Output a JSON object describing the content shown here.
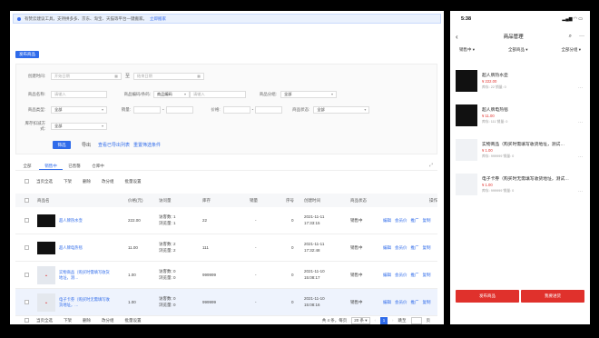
{
  "notice": {
    "text": "有赞云建议工具，支持拼多多、京东、淘宝、天猫等平台一键搬家。",
    "link": "立即搬家"
  },
  "publish_btn": "发布商品",
  "filters": {
    "created_label": "创建时间:",
    "start_ph": "开始日期",
    "to": "至",
    "end_ph": "结束日期",
    "name_label": "商品名称:",
    "name_ph": "请输入",
    "code_label": "商品编码/条码:",
    "code_select": "商品编码",
    "code_ph": "请输入",
    "group_label": "商品分组:",
    "group_val": "全部",
    "type_label": "商品类型:",
    "type_val": "全部",
    "sales_label": "销量:",
    "sales_sep": "-",
    "price_label": "价格:",
    "price_sep": "-",
    "status_label": "商品状态:",
    "status_val": "全部",
    "delivery_label": "库存扣减方式:",
    "delivery_val": "全部",
    "filter_btn": "筛选",
    "export_btn": "导出",
    "view_export": "查看已导出列表",
    "reset": "重置筛选条件"
  },
  "tabs": [
    "全部",
    "销售中",
    "已售罄",
    "仓库中"
  ],
  "actions": [
    "当页全选",
    "下架",
    "删除",
    "改分组",
    "批量设置"
  ],
  "columns": [
    "商品名",
    "价格(元)",
    "访问量",
    "库存",
    "销量",
    "序号",
    "创建时间",
    "商品状态",
    "操作"
  ],
  "rows": [
    {
      "name": "超人牌热水壶",
      "price": "222.00",
      "uv": "访客数: 1",
      "pv": "浏览量: 1",
      "stock": "22",
      "sales": "-",
      "seq": "0",
      "date": "2021-11-11",
      "time": "17:33:15",
      "status": "销售中"
    },
    {
      "name": "超人牌电热毯",
      "price": "11.00",
      "uv": "访客数: 2",
      "pv": "浏览量: 2",
      "stock": "111",
      "sales": "-",
      "seq": "0",
      "date": "2021-11-11",
      "time": "17:32:48",
      "status": "销售中"
    },
    {
      "name": "实物商品（购买时需填写收货地址，测…",
      "price": "1.00",
      "uv": "访客数: 0",
      "pv": "浏览量: 0",
      "stock": "999999",
      "sales": "-",
      "seq": "0",
      "date": "2021-11-10",
      "time": "15:08:17",
      "status": "销售中"
    },
    {
      "name": "电子卡券（购买时无需填写收货地址，…",
      "price": "1.00",
      "uv": "访客数: 0",
      "pv": "浏览量: 0",
      "stock": "999999",
      "sales": "-",
      "seq": "0",
      "date": "2021-11-10",
      "time": "15:08:16",
      "status": "销售中"
    }
  ],
  "row_ops": [
    "编辑",
    "会员价",
    "推广",
    "复制"
  ],
  "footer": {
    "total": "共 4 条，每页",
    "per_page": "20 条",
    "page": "1",
    "goto": "跳至",
    "page_unit": "页"
  },
  "mobile": {
    "time": "5:38",
    "title": "商品管理",
    "filters": [
      "销售中",
      "全部商品",
      "全部分组"
    ],
    "items": [
      {
        "title": "超人牌热水壶",
        "price": "¥ 222.00",
        "meta": "库存: 22   销量: 0"
      },
      {
        "title": "超人牌电热毯",
        "price": "¥ 11.00",
        "meta": "库存: 111   销量: 0"
      },
      {
        "title": "实物商品（购买时需填写收货地址，测试…",
        "price": "¥ 1.00",
        "meta": "库存: 999999   销量: 0"
      },
      {
        "title": "电子卡券（购买时无需填写收货地址，测试…",
        "price": "¥ 1.00",
        "meta": "库存: 999999   销量: 0"
      }
    ],
    "publish": "发布商品",
    "shop": "我要进货"
  }
}
